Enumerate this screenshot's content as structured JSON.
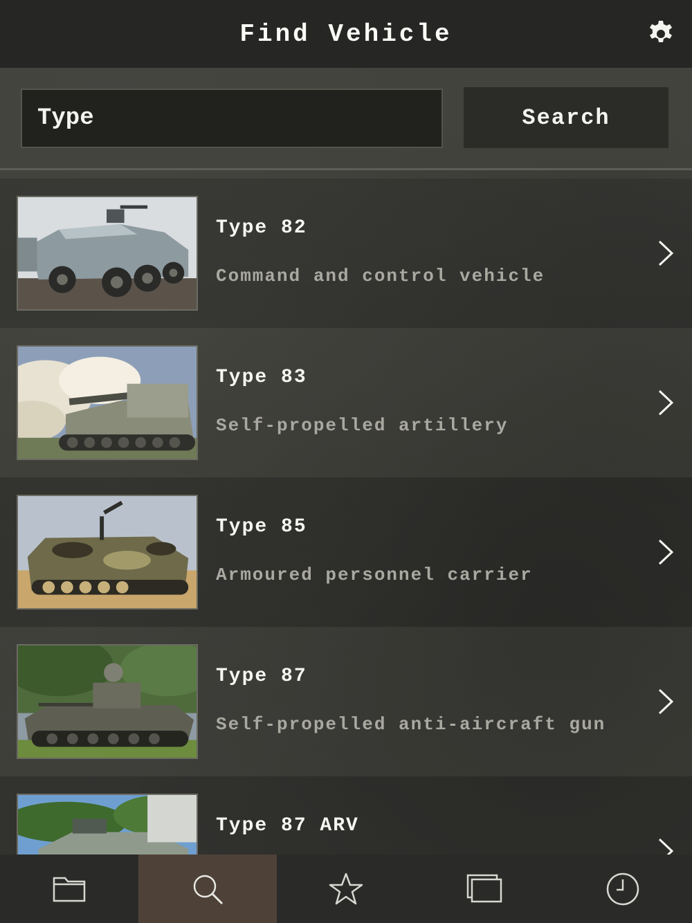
{
  "header": {
    "title": "Find Vehicle",
    "settings_icon": "gear-icon"
  },
  "search": {
    "placeholder": "Type",
    "value": "",
    "button_label": "Search"
  },
  "vehicles": [
    {
      "name": "Type 82",
      "description": "Command and control vehicle",
      "image": "wheeled-apc-photo"
    },
    {
      "name": "Type 83",
      "description": "Self-propelled artillery",
      "image": "howitzer-firing-photo"
    },
    {
      "name": "Type 85",
      "description": "Armoured personnel carrier",
      "image": "camo-apc-photo"
    },
    {
      "name": "Type 87",
      "description": "Self-propelled anti-aircraft gun",
      "image": "aa-gun-photo"
    },
    {
      "name": "Type 87 ARV",
      "description": "",
      "image": "recon-vehicle-photo"
    }
  ],
  "tabs": [
    {
      "id": "browse",
      "icon": "folder-icon",
      "active": false
    },
    {
      "id": "search",
      "icon": "search-icon",
      "active": true
    },
    {
      "id": "favorites",
      "icon": "star-icon",
      "active": false
    },
    {
      "id": "compare",
      "icon": "cards-icon",
      "active": false
    },
    {
      "id": "history",
      "icon": "clock-icon",
      "active": false
    }
  ],
  "colors": {
    "active_tab": "#4e4238",
    "header": "#262624",
    "description_text": "#a9a9a1"
  }
}
